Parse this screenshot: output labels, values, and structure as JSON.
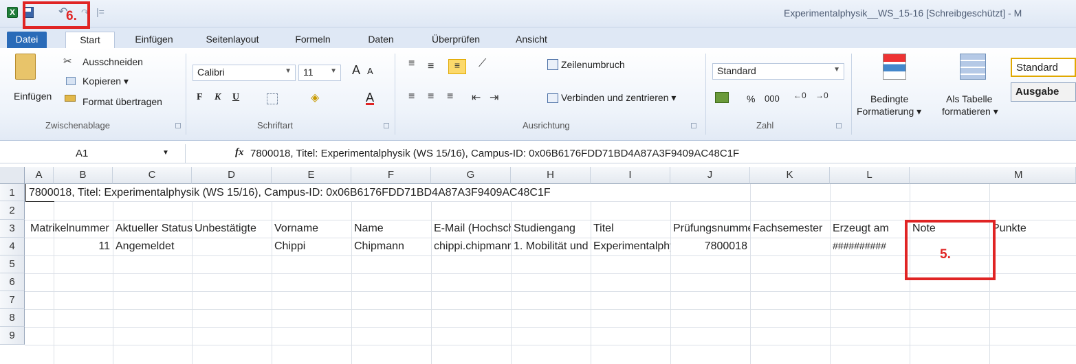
{
  "window": {
    "title": "Experimentalphysik__WS_15-16  [Schreibgeschützt] - M"
  },
  "qat": {
    "logo_text": "X",
    "undo_glyph": "↶",
    "redo_glyph": "↷",
    "sep": "|="
  },
  "tabs": [
    "Datei",
    "Start",
    "Einfügen",
    "Seitenlayout",
    "Formeln",
    "Daten",
    "Überprüfen",
    "Ansicht"
  ],
  "ribbon": {
    "clipboard": {
      "paste": "Einfügen",
      "cut": "Ausschneiden",
      "copy": "Kopieren ▾",
      "format_painter": "Format übertragen",
      "label": "Zwischenablage"
    },
    "font": {
      "name": "Calibri",
      "size": "11",
      "grow": "A",
      "shrink": "A",
      "bold": "F",
      "italic": "K",
      "underline": "U",
      "label": "Schriftart"
    },
    "alignment": {
      "wrap": "Zeilenumbruch",
      "merge": "Verbinden und zentrieren ▾",
      "label": "Ausrichtung"
    },
    "number": {
      "format": "Standard",
      "percent": "%",
      "thousands": "000",
      "label": "Zahl"
    },
    "styles": {
      "cond_format_1": "Bedingte",
      "cond_format_2": "Formatierung ▾",
      "table_1": "Als Tabelle",
      "table_2": "formatieren ▾",
      "style_standard": "Standard",
      "style_ausgabe": "Ausgabe"
    }
  },
  "formula_bar": {
    "name_box": "A1",
    "fx": "fx",
    "formula": "7800018, Titel: Experimentalphysik  (WS 15/16), Campus-ID: 0x06B6176FDD71BD4A87A3F9409AC48C1F"
  },
  "grid": {
    "columns": [
      "A",
      "B",
      "C",
      "D",
      "E",
      "F",
      "G",
      "H",
      "I",
      "J",
      "K",
      "L",
      "M"
    ],
    "rows": [
      "1",
      "2",
      "3",
      "4",
      "5",
      "6",
      "7",
      "8",
      "9"
    ],
    "r1_a": "7800018, Titel: Experimentalphysik  (WS 15/16), Campus-ID: 0x06B6176FDD71BD4A87A3F9409AC48C1F",
    "headers": [
      "Matrikelnummer",
      "Aktueller Status",
      "Unbestätigte",
      "Vorname",
      "Name",
      "E-Mail (Hochschule)",
      "Studiengang",
      "Titel",
      "Prüfungsnummer",
      "Fachsemester",
      "Erzeugt am",
      "Note",
      "Punkte"
    ],
    "row4": {
      "a": "11",
      "b": "Angemeldet",
      "c": "",
      "d": "Chippi",
      "e": "Chipmann",
      "f": "chippi.chipmann",
      "g": "1. Mobilität und",
      "h": "Experimentalphysik",
      "i": "7800018",
      "j": "",
      "k": "##########",
      "l": "",
      "m": ""
    }
  },
  "annotations": {
    "step5": "5.",
    "step6": "6."
  }
}
